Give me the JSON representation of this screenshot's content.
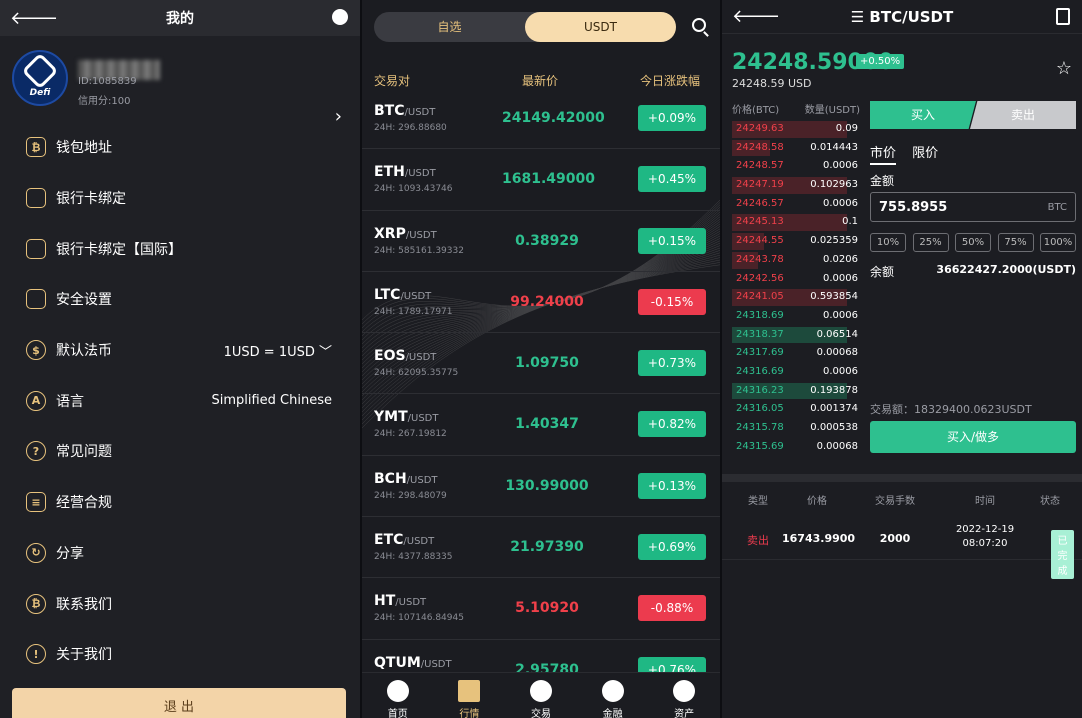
{
  "profile": {
    "header_title": "我的",
    "avatar_label": "Defi",
    "uid": "ID:1085839",
    "credit": "信用分:100",
    "menu": [
      {
        "label": "钱包地址",
        "icon": "bitcoin-wallet-icon",
        "glyph": "₿",
        "value": ""
      },
      {
        "label": "银行卡绑定",
        "icon": "bank-card-icon",
        "glyph": "",
        "value": ""
      },
      {
        "label": "银行卡绑定【国际】",
        "icon": "bank-card-icon",
        "glyph": "",
        "value": ""
      },
      {
        "label": "安全设置",
        "icon": "shield-icon",
        "glyph": "",
        "value": ""
      },
      {
        "label": "默认法币",
        "icon": "dollar-icon",
        "glyph": "$",
        "value": "1USD = 1USD ﹀"
      },
      {
        "label": "语言",
        "icon": "language-icon",
        "glyph": "A",
        "value": "Simplified Chinese"
      },
      {
        "label": "常见问题",
        "icon": "question-icon",
        "glyph": "?",
        "value": ""
      },
      {
        "label": "经营合规",
        "icon": "license-icon",
        "glyph": "≡",
        "value": ""
      },
      {
        "label": "分享",
        "icon": "share-icon",
        "glyph": "↻",
        "value": ""
      },
      {
        "label": "联系我们",
        "icon": "contact-icon",
        "glyph": "₿",
        "value": ""
      },
      {
        "label": "关于我们",
        "icon": "info-icon",
        "glyph": "!",
        "value": ""
      }
    ],
    "logout": "退 出"
  },
  "market": {
    "tabs": [
      "自选",
      "USDT"
    ],
    "active_tab": "USDT",
    "headers": {
      "pair": "交易对",
      "price": "最新价",
      "change": "今日涨跌幅"
    },
    "rows": [
      {
        "base": "BTC",
        "quote": "/USDT",
        "vol": "24H: 296.88680",
        "price": "24149.42000",
        "change": "+0.09%",
        "dir": "up"
      },
      {
        "base": "ETH",
        "quote": "/USDT",
        "vol": "24H: 1093.43746",
        "price": "1681.49000",
        "change": "+0.45%",
        "dir": "up"
      },
      {
        "base": "XRP",
        "quote": "/USDT",
        "vol": "24H: 585161.39332",
        "price": "0.38929",
        "change": "+0.15%",
        "dir": "up"
      },
      {
        "base": "LTC",
        "quote": "/USDT",
        "vol": "24H: 1789.17971",
        "price": "99.24000",
        "change": "-0.15%",
        "dir": "dn"
      },
      {
        "base": "EOS",
        "quote": "/USDT",
        "vol": "24H: 62095.35775",
        "price": "1.09750",
        "change": "+0.73%",
        "dir": "up"
      },
      {
        "base": "YMT",
        "quote": "/USDT",
        "vol": "24H: 267.19812",
        "price": "1.40347",
        "change": "+0.82%",
        "dir": "up"
      },
      {
        "base": "BCH",
        "quote": "/USDT",
        "vol": "24H: 298.48079",
        "price": "130.99000",
        "change": "+0.13%",
        "dir": "up"
      },
      {
        "base": "ETC",
        "quote": "/USDT",
        "vol": "24H: 4377.88335",
        "price": "21.97390",
        "change": "+0.69%",
        "dir": "up"
      },
      {
        "base": "HT",
        "quote": "/USDT",
        "vol": "24H: 107146.84945",
        "price": "5.10920",
        "change": "-0.88%",
        "dir": "dn"
      },
      {
        "base": "QTUM",
        "quote": "/USDT",
        "vol": "",
        "price": "2.95780",
        "change": "+0.76%",
        "dir": "up"
      }
    ],
    "tabbar": [
      {
        "label": "首页",
        "icon": "home-icon"
      },
      {
        "label": "行情",
        "icon": "market-chart-icon"
      },
      {
        "label": "交易",
        "icon": "trade-icon"
      },
      {
        "label": "金融",
        "icon": "finance-icon"
      },
      {
        "label": "资产",
        "icon": "assets-pie-icon"
      }
    ],
    "active_tabbar": "行情"
  },
  "trade": {
    "title": "BTC/USDT",
    "last_price": "24248.59000",
    "change_badge": "+0.50%",
    "usd_price": "24248.59 USD",
    "ob_price_header": "价格(BTC)",
    "ob_qty_header": "数量(USDT)",
    "asks": [
      {
        "price": "24249.63",
        "qty": "0.09",
        "depth": 0.9
      },
      {
        "price": "24248.58",
        "qty": "0.014443",
        "depth": 0.3
      },
      {
        "price": "24248.57",
        "qty": "0.0006",
        "depth": 0
      },
      {
        "price": "24247.19",
        "qty": "0.102963",
        "depth": 0.9
      },
      {
        "price": "24246.57",
        "qty": "0.0006",
        "depth": 0
      },
      {
        "price": "24245.13",
        "qty": "0.1",
        "depth": 0.9
      },
      {
        "price": "24244.55",
        "qty": "0.025359",
        "depth": 0.25
      },
      {
        "price": "24243.78",
        "qty": "0.0206",
        "depth": 0.2
      },
      {
        "price": "24242.56",
        "qty": "0.0006",
        "depth": 0
      },
      {
        "price": "24241.05",
        "qty": "0.593854",
        "depth": 0.9
      }
    ],
    "bids": [
      {
        "price": "24318.69",
        "qty": "0.0006",
        "depth": 0
      },
      {
        "price": "24318.37",
        "qty": "0.06514",
        "depth": 0.9
      },
      {
        "price": "24317.69",
        "qty": "0.00068",
        "depth": 0
      },
      {
        "price": "24316.69",
        "qty": "0.0006",
        "depth": 0
      },
      {
        "price": "24316.23",
        "qty": "0.193878",
        "depth": 0.9
      },
      {
        "price": "24316.05",
        "qty": "0.001374",
        "depth": 0
      },
      {
        "price": "24315.78",
        "qty": "0.000538",
        "depth": 0
      },
      {
        "price": "24315.69",
        "qty": "0.00068",
        "depth": 0
      }
    ],
    "buy_label": "买入",
    "sell_label": "卖出",
    "order_types": [
      "市价",
      "限价"
    ],
    "amount_label": "金额",
    "amount_value": "755.8955",
    "amount_unit": "BTC",
    "percents": [
      "10%",
      "25%",
      "50%",
      "75%",
      "100%"
    ],
    "balance_label": "余额",
    "balance_value": "36622427.2000(USDT)",
    "trade_volume": "交易额：18329400.0623USDT",
    "buy_button": "买入/做多",
    "history_headers": [
      "类型",
      "价格",
      "交易手数",
      "时间",
      "状态"
    ],
    "history": [
      {
        "type": "卖出",
        "price": "16743.9900",
        "lots": "2000",
        "date": "2022-12-19",
        "time": "08:07:20",
        "status": "已完成"
      }
    ]
  },
  "colors": {
    "up": "#2ec08f",
    "down": "#ec3b4e",
    "accent": "#e7c27d"
  }
}
